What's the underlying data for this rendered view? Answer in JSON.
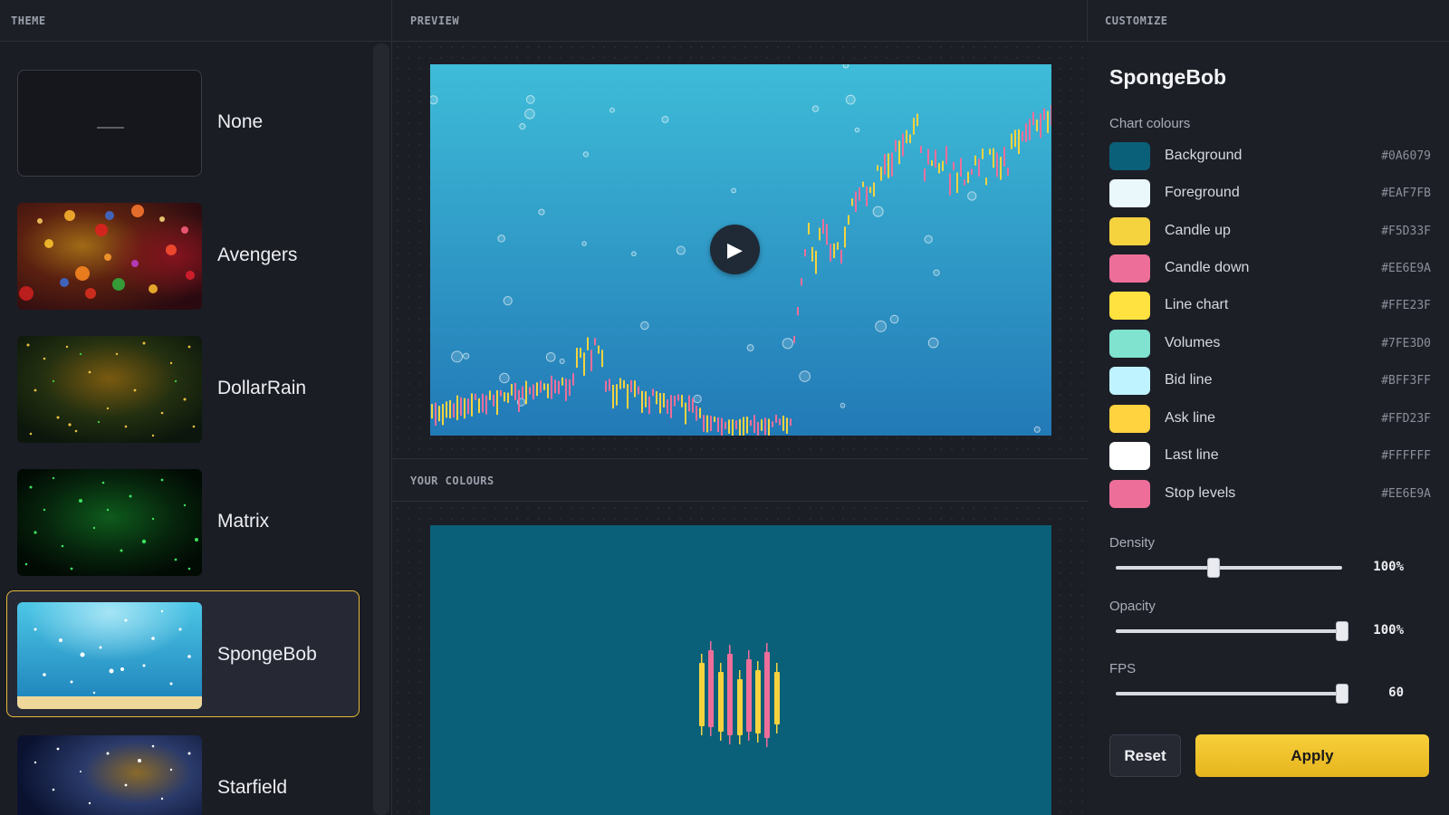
{
  "panels": {
    "theme": "THEME",
    "preview": "PREVIEW",
    "your_colours": "YOUR COLOURS",
    "customize": "CUSTOMIZE"
  },
  "themes": [
    {
      "name": "None",
      "selected": false
    },
    {
      "name": "Avengers",
      "selected": false
    },
    {
      "name": "DollarRain",
      "selected": false
    },
    {
      "name": "Matrix",
      "selected": false
    },
    {
      "name": "SpongeBob",
      "selected": true
    },
    {
      "name": "Starfield",
      "selected": false
    }
  ],
  "customize": {
    "title": "SpongeBob",
    "chart_colours_label": "Chart colours",
    "colours": [
      {
        "name": "Background",
        "hex": "#0A6079"
      },
      {
        "name": "Foreground",
        "hex": "#EAF7FB"
      },
      {
        "name": "Candle up",
        "hex": "#F5D33F"
      },
      {
        "name": "Candle down",
        "hex": "#EE6E9A"
      },
      {
        "name": "Line chart",
        "hex": "#FFE23F"
      },
      {
        "name": "Volumes",
        "hex": "#7FE3D0"
      },
      {
        "name": "Bid line",
        "hex": "#BFF3FF"
      },
      {
        "name": "Ask line",
        "hex": "#FFD23F"
      },
      {
        "name": "Last line",
        "hex": "#FFFFFF"
      },
      {
        "name": "Stop levels",
        "hex": "#EE6E9A"
      }
    ],
    "sliders": {
      "density": {
        "label": "Density",
        "value": "100%",
        "level": 0.43
      },
      "opacity": {
        "label": "Opacity",
        "value": "100%",
        "level": 1.0
      },
      "fps": {
        "label": "FPS",
        "value": "60",
        "level": 1.0
      }
    },
    "reset_label": "Reset",
    "apply_label": "Apply"
  },
  "icons": {
    "play": "play-icon",
    "none_theme": "dash-icon"
  }
}
